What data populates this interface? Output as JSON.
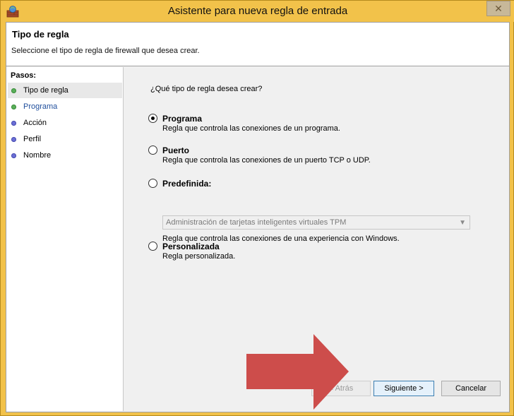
{
  "window": {
    "title": "Asistente para nueva regla de entrada",
    "close_glyph": "✕"
  },
  "header": {
    "title": "Tipo de regla",
    "subtitle": "Seleccione el tipo de regla de firewall que desea crear."
  },
  "steps": {
    "title": "Pasos:",
    "items": [
      {
        "label": "Tipo de regla",
        "status": "green",
        "current": true
      },
      {
        "label": "Programa",
        "status": "green",
        "current": false
      },
      {
        "label": "Acción",
        "status": "blue",
        "current": false
      },
      {
        "label": "Perfil",
        "status": "blue",
        "current": false
      },
      {
        "label": "Nombre",
        "status": "blue",
        "current": false
      }
    ]
  },
  "main": {
    "question": "¿Qué tipo de regla desea crear?",
    "options": [
      {
        "label": "Programa",
        "desc": "Regla que controla las conexiones de un programa.",
        "checked": true
      },
      {
        "label": "Puerto",
        "desc": "Regla que controla las conexiones de un puerto TCP o UDP.",
        "checked": false
      },
      {
        "label": "Predefinida:",
        "desc": "Regla que controla las conexiones de una experiencia con Windows.",
        "checked": false
      },
      {
        "label": "Personalizada",
        "desc": "Regla personalizada.",
        "checked": false
      }
    ],
    "predefined_select": {
      "value": "Administración de tarjetas inteligentes virtuales TPM"
    }
  },
  "buttons": {
    "back": "< Atrás",
    "next": "Siguiente >",
    "cancel": "Cancelar"
  },
  "colors": {
    "arrow": "#cd4d4b",
    "titlebar": "#f2c24a",
    "step_green": "#5ab05a",
    "step_blue": "#6b6fd6"
  }
}
